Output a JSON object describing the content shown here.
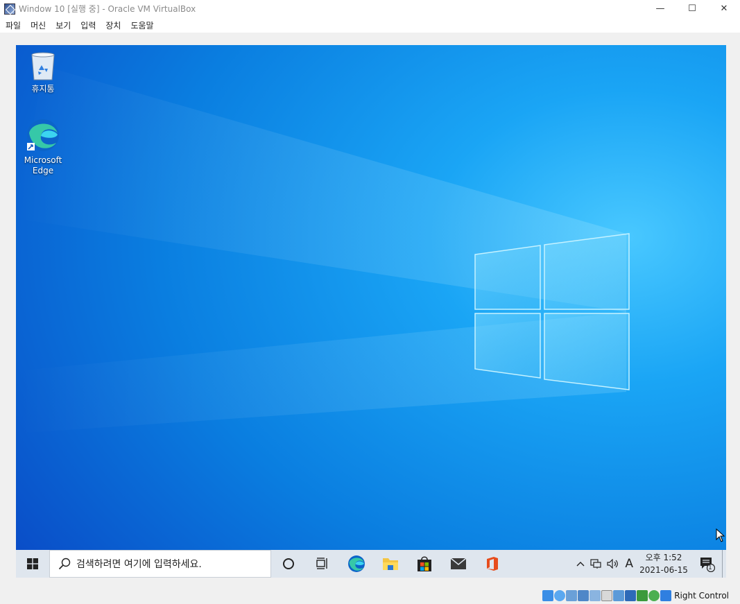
{
  "window": {
    "title": "Window 10 [실행 중] - Oracle VM VirtualBox",
    "controls": {
      "minimize": "—",
      "maximize": "☐",
      "close": "✕"
    }
  },
  "menu": [
    "파일",
    "머신",
    "보기",
    "입력",
    "장치",
    "도움말"
  ],
  "desktop": {
    "icons": [
      {
        "label": "휴지통",
        "icon": "recycle-bin-icon"
      },
      {
        "label": "Microsoft Edge",
        "icon": "edge-icon"
      }
    ]
  },
  "taskbar": {
    "search_placeholder": "검색하려면 여기에 입력하세요.",
    "pinned": [
      "cortana-icon",
      "task-view-icon",
      "edge-icon",
      "file-explorer-icon",
      "store-icon",
      "mail-icon",
      "office-icon"
    ],
    "tray": {
      "input_indicator": "A",
      "time": "오후 1:52",
      "date": "2021-06-15",
      "notification_count": "1"
    }
  },
  "statusbar": {
    "host_key": "Right Control"
  },
  "colors": {
    "wallpaper_deep": "#0a46c4",
    "wallpaper_light": "#1aa5f5",
    "taskbar_bg": "#dfe6ee"
  }
}
